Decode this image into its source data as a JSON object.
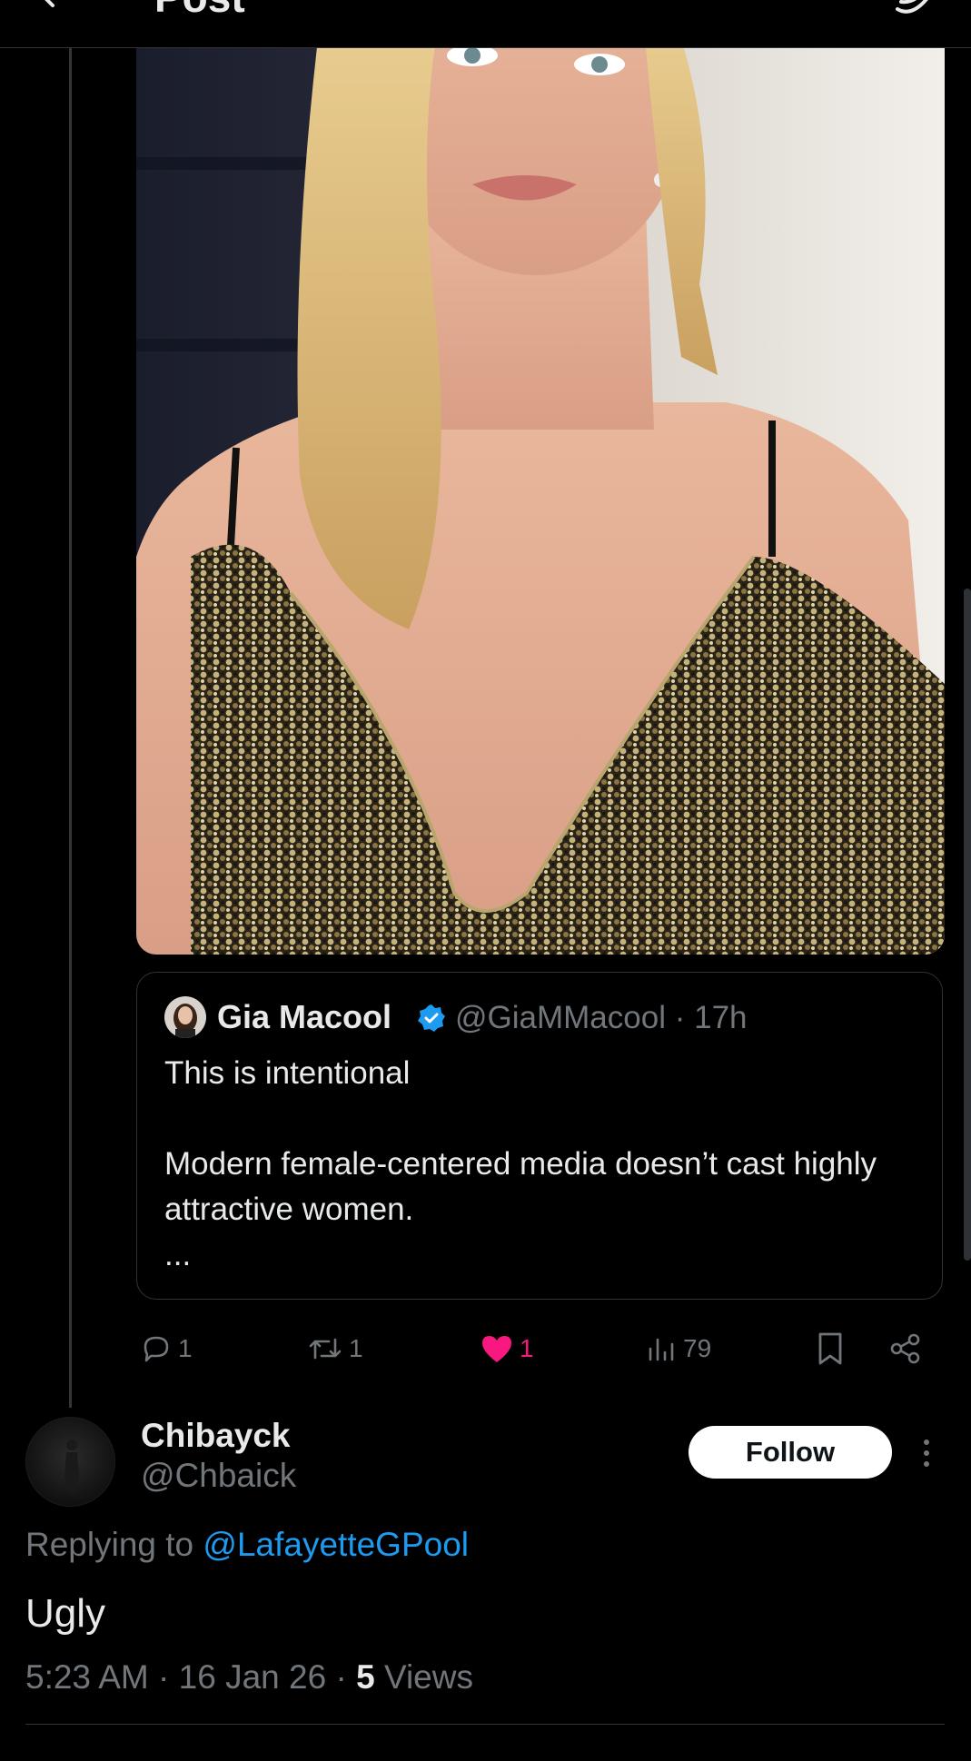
{
  "header": {
    "title": "Post",
    "back_icon": "arrow-left-icon",
    "grok_icon": "grok-icon"
  },
  "photo": {
    "subject": "blonde-woman-sequin-dress-photo"
  },
  "quote": {
    "author_name": "Gia Macool",
    "handle": "@GiaMMacool",
    "separator": "·",
    "time": "17h",
    "lines": [
      "This is intentional",
      "Modern female-centered media doesn’t cast highly attractive women."
    ],
    "ellipsis": "...",
    "verified_color": "#1d9bf0"
  },
  "actions": {
    "replies": "1",
    "reposts": "1",
    "likes": "1",
    "views": "79",
    "like_color": "#f91880"
  },
  "reply": {
    "author_name": "Chibayck",
    "handle": "@Chbaick",
    "follow_label": "Follow",
    "replying_prefix": "Replying to",
    "replying_mention": "@LafayetteGPool",
    "text": "Ugly",
    "time": "5:23 AM",
    "date": "16 Jan 26",
    "views_count": "5",
    "views_label": "Views",
    "dot": "·",
    "mention_color": "#1d9bf0"
  }
}
